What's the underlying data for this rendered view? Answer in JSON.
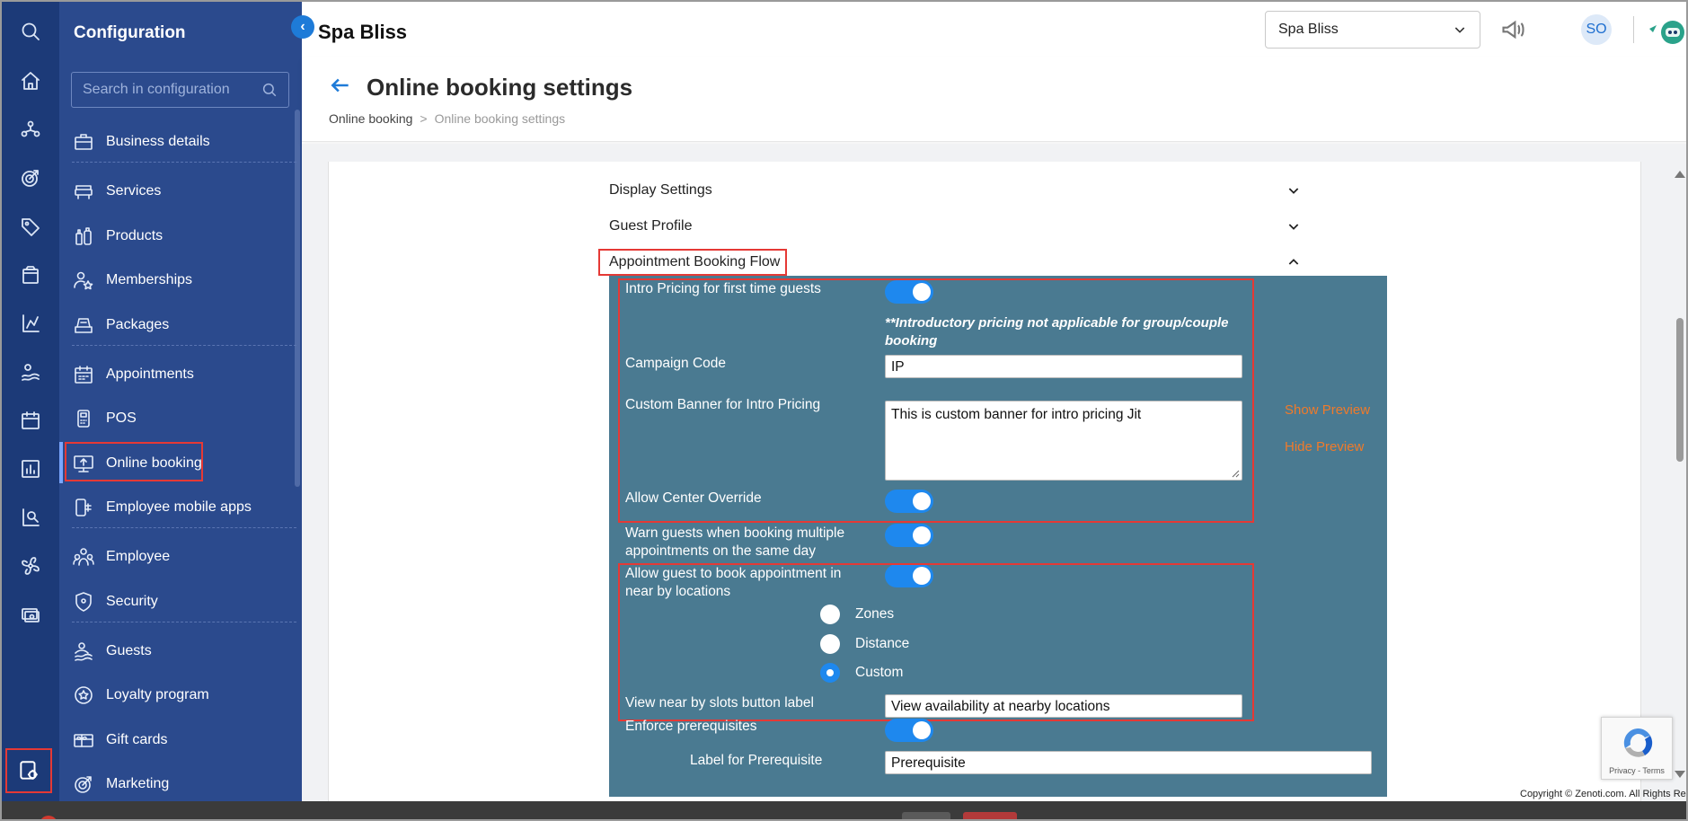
{
  "header": {
    "app_title": "Spa Bliss",
    "location_select": "Spa Bliss",
    "avatar_initials": "SO",
    "page_title": "Online booking settings",
    "breadcrumb": [
      "Online booking",
      ">",
      "Online booking settings"
    ]
  },
  "sidebar": {
    "title": "Configuration",
    "search_placeholder": "Search in configuration",
    "items": [
      {
        "label": "Business details",
        "icon": "briefcase-icon"
      },
      {
        "label": "Services",
        "icon": "spa-chair-icon"
      },
      {
        "label": "Products",
        "icon": "bottles-icon"
      },
      {
        "label": "Memberships",
        "icon": "member-star-icon"
      },
      {
        "label": "Packages",
        "icon": "package-tray-icon"
      },
      {
        "label": "Appointments",
        "icon": "calendar-icon"
      },
      {
        "label": "POS",
        "icon": "pos-terminal-icon"
      },
      {
        "label": "Online booking",
        "icon": "monitor-icon"
      },
      {
        "label": "Employee mobile apps",
        "icon": "mobile-apps-icon"
      },
      {
        "label": "Employee",
        "icon": "people-icon"
      },
      {
        "label": "Security",
        "icon": "shield-icon"
      },
      {
        "label": "Guests",
        "icon": "guests-icon"
      },
      {
        "label": "Loyalty program",
        "icon": "loyalty-icon"
      },
      {
        "label": "Gift cards",
        "icon": "gift-card-icon"
      },
      {
        "label": "Marketing",
        "icon": "marketing-icon"
      }
    ],
    "active_item": "Online booking"
  },
  "rail": {
    "icons": [
      "search-icon",
      "home-icon",
      "org-icon",
      "target-icon",
      "tag-icon",
      "box-icon",
      "analytics-icon",
      "spa-icon",
      "calendar-icon",
      "report-icon",
      "insights-icon",
      "fan-icon",
      "money-icon"
    ],
    "bottom_icon": "settings-icon"
  },
  "accordion": {
    "sections": [
      {
        "label": "Display Settings",
        "expanded": false
      },
      {
        "label": "Guest Profile",
        "expanded": false
      },
      {
        "label": "Appointment Booking Flow",
        "expanded": true
      }
    ]
  },
  "booking_flow": {
    "intro_pricing_label": "Intro Pricing for first time guests",
    "intro_pricing_on": true,
    "intro_note": "**Introductory pricing not applicable for group/couple booking",
    "campaign_code_label": "Campaign Code",
    "campaign_code_value": "IP",
    "custom_banner_label": "Custom Banner for Intro Pricing",
    "custom_banner_value": "This is custom banner for intro pricing  Jit",
    "show_preview": "Show Preview",
    "hide_preview": "Hide Preview",
    "allow_center_override_label": "Allow Center Override",
    "warn_guests_label": "Warn guests when booking multiple appointments on the same day",
    "nearby_label": "Allow guest to book appointment in near by locations",
    "radio_options": [
      "Zones",
      "Distance",
      "Custom"
    ],
    "radio_selected": "Custom",
    "nearby_button_label": "View near by slots button label",
    "nearby_button_value": "View availability at nearby locations",
    "enforce_prereq_label": "Enforce prerequisites",
    "prereq_label_label": "Label for Prerequisite",
    "prereq_label_value": "Prerequisite"
  },
  "footer": {
    "recaptcha_terms": "Privacy - Terms",
    "copyright": "Copyright © Zenoti.com. All Rights Res"
  },
  "colors": {
    "rail_bg": "#1c3a78",
    "sidebar_bg": "#2b4a8d",
    "panel_bg": "#4a7a91",
    "accent": "#1e88ee",
    "highlight": "#e53935",
    "link_orange": "#f07a2a"
  }
}
